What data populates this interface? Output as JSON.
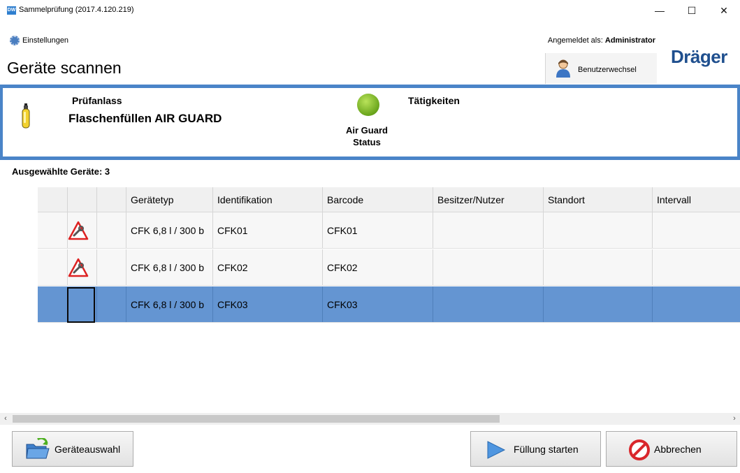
{
  "window": {
    "title": "Sammelprüfung (2017.4.120.219)",
    "app_badge": "DW",
    "controls": {
      "minimize": "—",
      "maximize": "☐",
      "close": "✕"
    }
  },
  "menu": {
    "settings_label": "Einstellungen"
  },
  "header": {
    "logged_in_prefix": "Angemeldet als:",
    "logged_in_user": "Administrator",
    "page_title": "Geräte scannen",
    "user_switch_label": "Benutzerwechsel",
    "logo_text": "Dräger"
  },
  "info": {
    "reason_label": "Prüfanlass",
    "reason_value": "Flaschenfüllen AIR GUARD",
    "status_line1": "Air Guard",
    "status_line2": "Status",
    "status_color": "#7cb52a",
    "activities_label": "Tätigkeiten"
  },
  "devices": {
    "selected_label": "Ausgewählte Geräte: 3",
    "columns": [
      "Gerätetyp",
      "Identifikation",
      "Barcode",
      "Besitzer/Nutzer",
      "Standort",
      "Intervall"
    ],
    "rows": [
      {
        "type": "CFK 6,8 l / 300 b",
        "id": "CFK01",
        "barcode": "CFK01",
        "owner": "",
        "location": "",
        "interval": "",
        "icon": "warning-wrench-icon",
        "selected": false
      },
      {
        "type": "CFK 6,8 l / 300 b",
        "id": "CFK02",
        "barcode": "CFK02",
        "owner": "",
        "location": "",
        "interval": "",
        "icon": "warning-wrench-icon",
        "selected": false
      },
      {
        "type": "CFK 6,8 l / 300 b",
        "id": "CFK03",
        "barcode": "CFK03",
        "owner": "",
        "location": "",
        "interval": "",
        "icon": "",
        "selected": true
      }
    ],
    "selection_color": "#6495d2"
  },
  "scrollbar": {
    "left_arrow": "‹",
    "right_arrow": "›"
  },
  "footer": {
    "device_select_label": "Geräteauswahl",
    "start_fill_label": "Füllung starten",
    "cancel_label": "Abbrechen"
  }
}
